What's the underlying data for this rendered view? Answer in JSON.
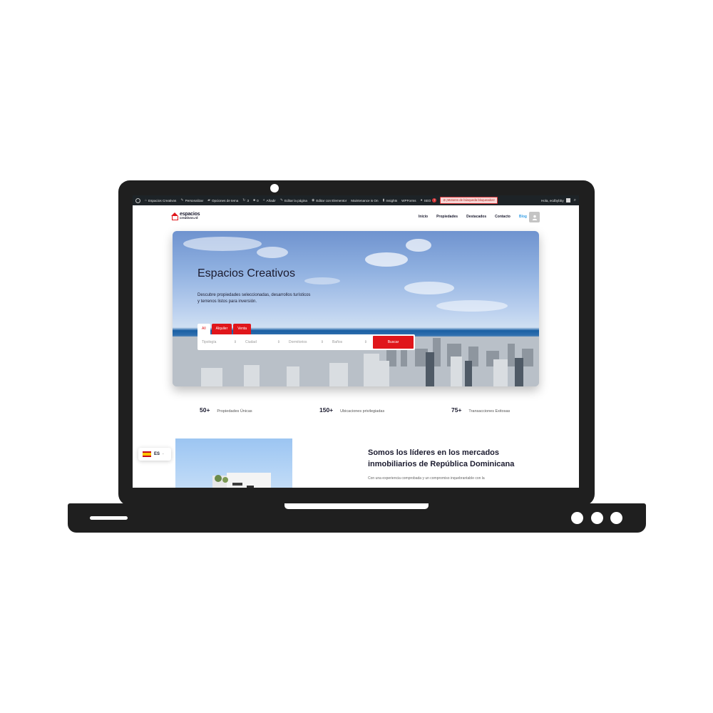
{
  "adminbar": {
    "site_name": "Espacios Creativos",
    "customize": "Personalizar",
    "theme_options": "Opciones de tema",
    "updates_count": "3",
    "comments_count": "0",
    "add_new": "Añadir",
    "edit_page": "Editar la página",
    "elementor": "Editar con Elementor",
    "maintenance": "Maintenance is On",
    "insights": "Insights",
    "wpforms": "WPForms",
    "seo": "SEO",
    "seo_badge": "7",
    "search_engine_alert": "¡Motores de búsqueda bloqueados!",
    "greeting": "Hola, ecdbybby"
  },
  "header": {
    "logo_line1": "espacios",
    "logo_line2": "creativos.rd",
    "nav": [
      "Inicio",
      "Propiedades",
      "Destacados",
      "Contacto"
    ],
    "nav_blog": "Blog",
    "user_icon": "user-icon"
  },
  "hero": {
    "title": "Espacios Creativos",
    "description": "Descubre propiedades seleccionadas, desarrollos turísticos y terrenos listos para inversión.",
    "tabs": [
      "All",
      "Alquiler",
      "Venta"
    ],
    "fields": [
      "Tipología",
      "Ciudad",
      "Dormitorios",
      "Baños"
    ],
    "search_button": "Buscar"
  },
  "stats": [
    {
      "number": "50+",
      "label": "Propiedades Únicas"
    },
    {
      "number": "150+",
      "label": "Ubicaciones privilegiadas"
    },
    {
      "number": "75+",
      "label": "Transacciones Exitosas"
    }
  ],
  "language": {
    "code": "ES"
  },
  "about": {
    "title": "Somos los líderes en los mercados inmobiliarios de República Dominicana",
    "text": "Con una experiencia comprobada y un compromiso inquebrantable con la"
  },
  "colors": {
    "accent": "#e0161b",
    "dark": "#1f1f1f",
    "link": "#3aa0e6"
  }
}
